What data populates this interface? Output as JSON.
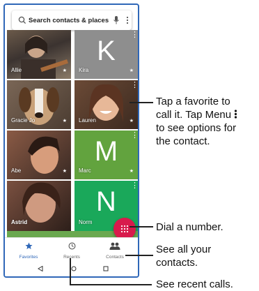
{
  "search": {
    "placeholder": "Search contacts & places"
  },
  "favorites": [
    {
      "name": "Allie",
      "type": "photo"
    },
    {
      "name": "Kira",
      "type": "letter",
      "letter": "K",
      "color": "#8e8e8e"
    },
    {
      "name": "Gracie Jo",
      "type": "photo"
    },
    {
      "name": "Lauren",
      "type": "photo"
    },
    {
      "name": "Abe",
      "type": "photo"
    },
    {
      "name": "Marc",
      "type": "letter",
      "letter": "M",
      "color": "#62a33e"
    },
    {
      "name": "Astrid",
      "type": "photo"
    },
    {
      "name": "Norm",
      "type": "letter",
      "letter": "N",
      "color": "#1aa85a"
    }
  ],
  "tabs": [
    {
      "label": "Favorites",
      "icon": "star-icon",
      "active": true
    },
    {
      "label": "Recents",
      "icon": "clock-icon",
      "active": false
    },
    {
      "label": "Contacts",
      "icon": "people-icon",
      "active": false
    }
  ],
  "callouts": {
    "favorite_line1": "Tap a favorite to",
    "favorite_line2": "call it. Tap Menu",
    "favorite_line3": "to see options for",
    "favorite_line4": "the contact.",
    "dial": "Dial a number.",
    "contacts_line1": "See all your",
    "contacts_line2": "contacts.",
    "recents": "See recent calls."
  },
  "colors": {
    "accent": "#2f67b8",
    "fab": "#d81b4c",
    "kira_tile": "#8e8e8e",
    "marc_tile": "#62a33e",
    "norm_tile": "#1aa85a"
  }
}
